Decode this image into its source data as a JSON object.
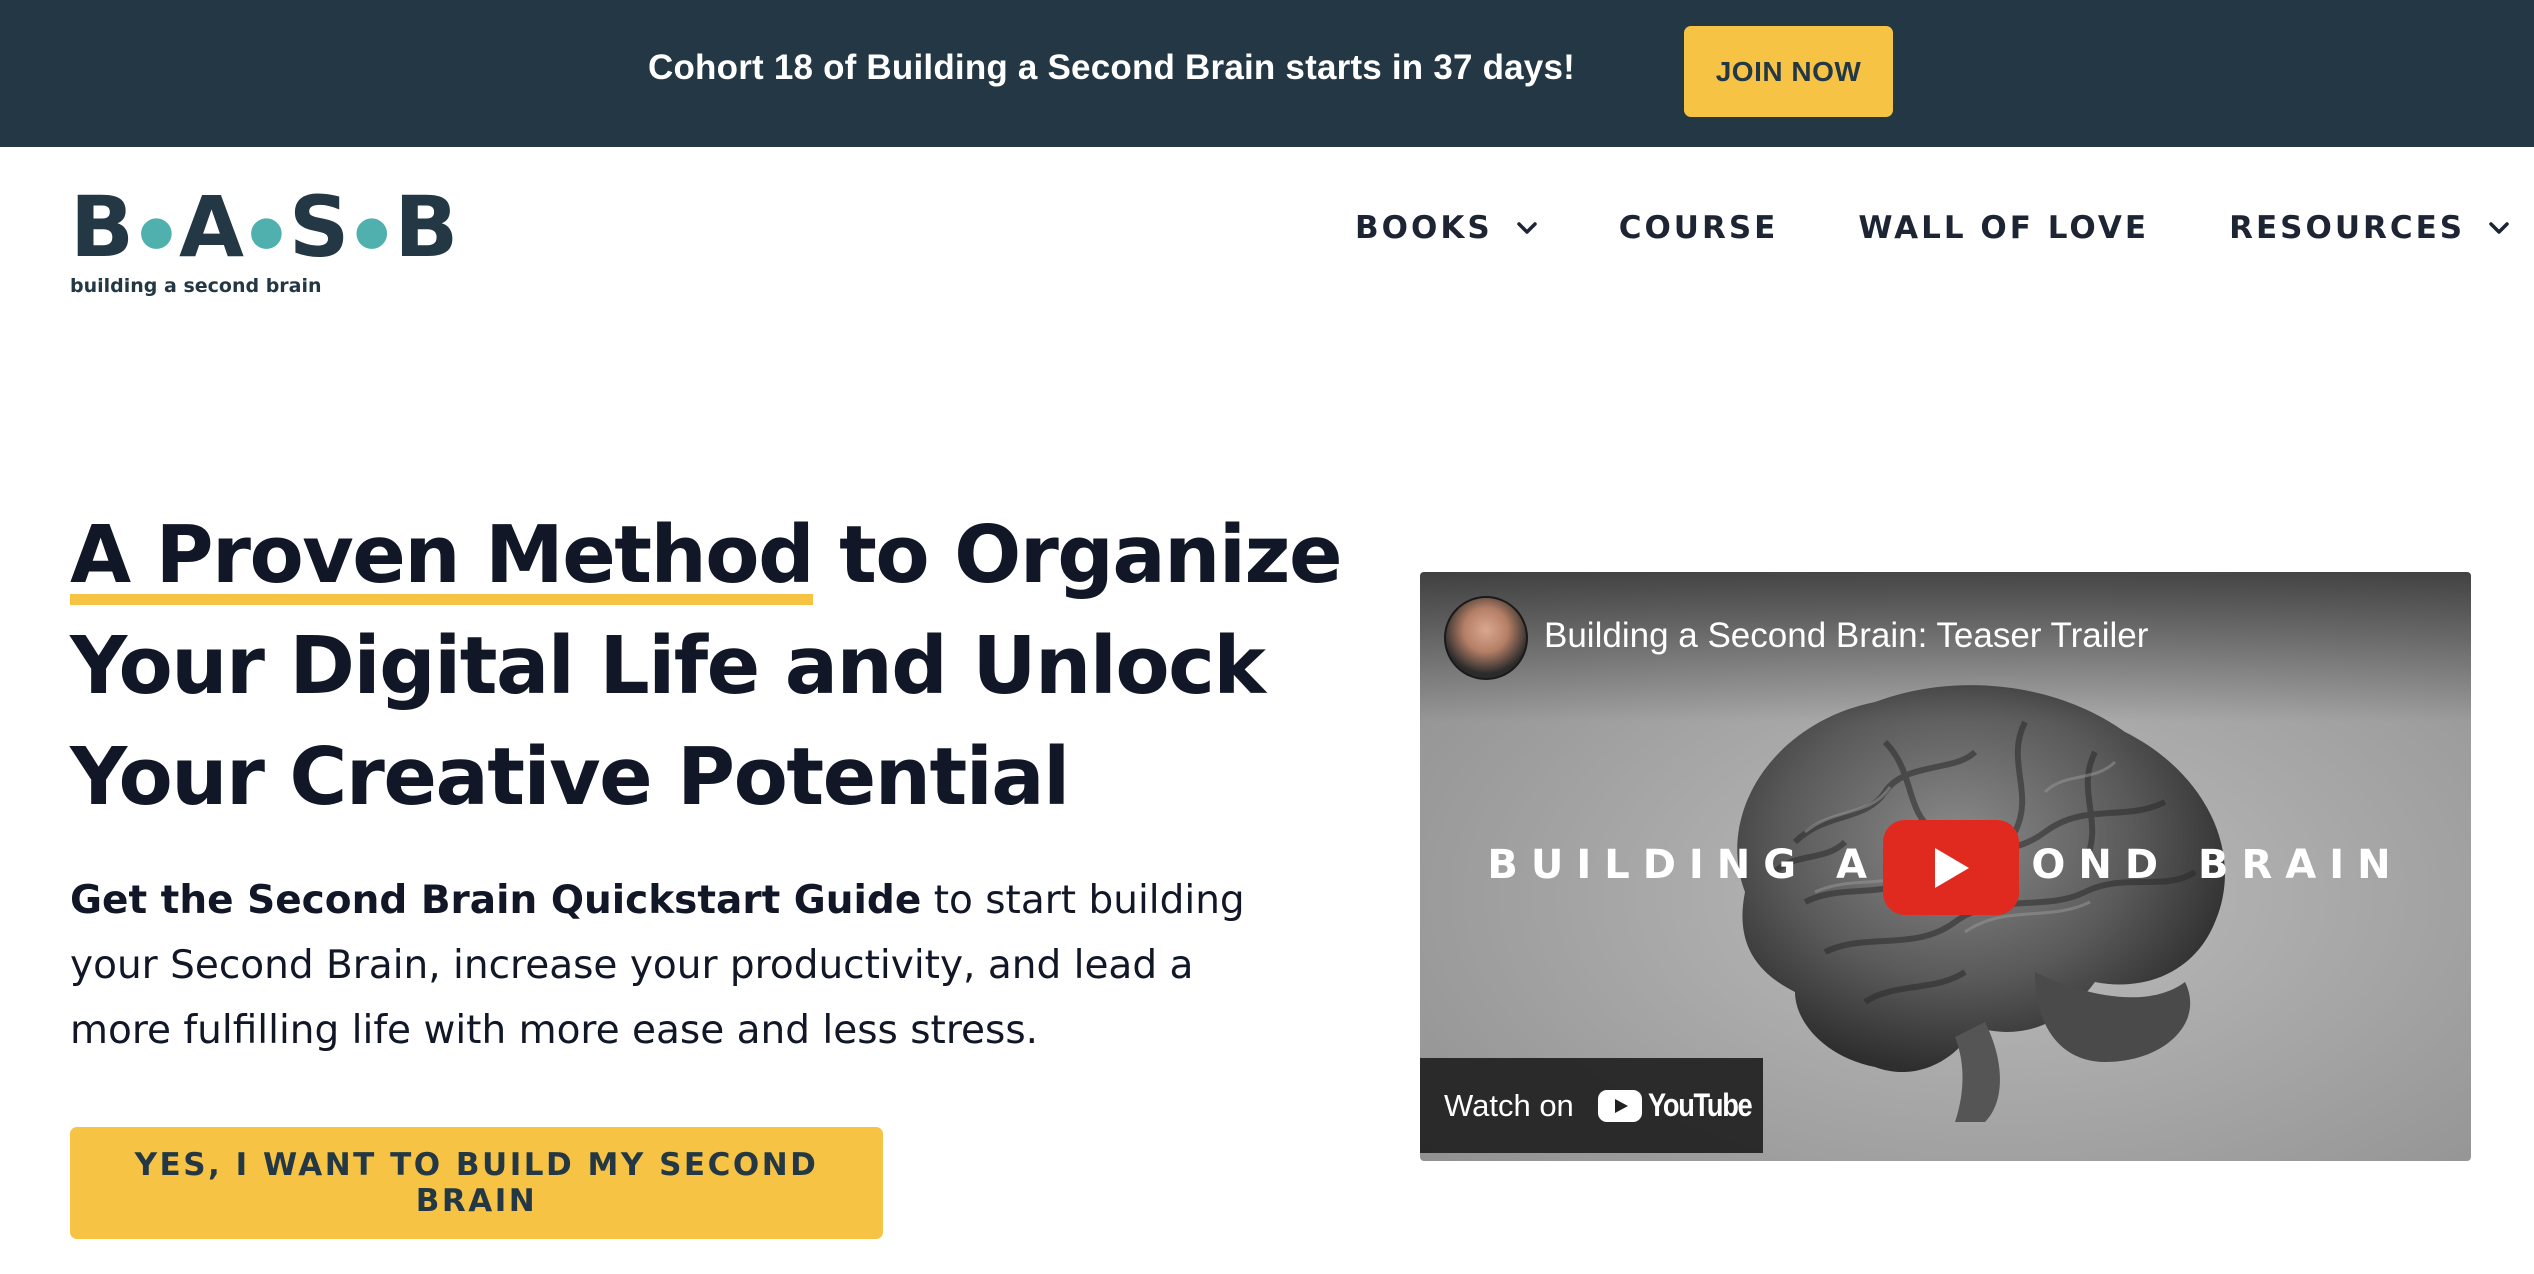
{
  "announcement": {
    "text": "Cohort 18 of Building a Second Brain starts in 37 days!",
    "button_label": "JOIN NOW"
  },
  "logo": {
    "letters": [
      "B",
      "A",
      "S",
      "B"
    ],
    "tagline": "building a second brain"
  },
  "nav": {
    "items": [
      {
        "label": "BOOKS",
        "has_dropdown": true
      },
      {
        "label": "COURSE",
        "has_dropdown": false
      },
      {
        "label": "WALL OF LOVE",
        "has_dropdown": false
      },
      {
        "label": "RESOURCES",
        "has_dropdown": true
      }
    ]
  },
  "hero": {
    "title_highlight": "A Proven Method",
    "title_line1_rest": " to Organize",
    "title_line2": "Your Digital Life and Unlock",
    "title_line3": "Your Creative Potential",
    "text_bold": "Get the Second Brain Quickstart Guide",
    "text_line1_rest": " to start building",
    "text_line2": "your Second Brain, increase your productivity, and lead a",
    "text_line3": "more fulfilling life with more ease and less stress.",
    "cta_label": "YES, I WANT TO BUILD MY SECOND BRAIN"
  },
  "video": {
    "title": "Building a Second Brain: Teaser Trailer",
    "overlay_text": "BUILDING A SECOND BRAIN",
    "watch_on_label": "Watch on",
    "platform_name": "YouTube"
  },
  "colors": {
    "topbar_bg": "#233844",
    "accent_yellow": "#f6c344",
    "text_dark": "#111726",
    "logo_dot": "#4fb0ae",
    "play_red": "#e02a20"
  }
}
